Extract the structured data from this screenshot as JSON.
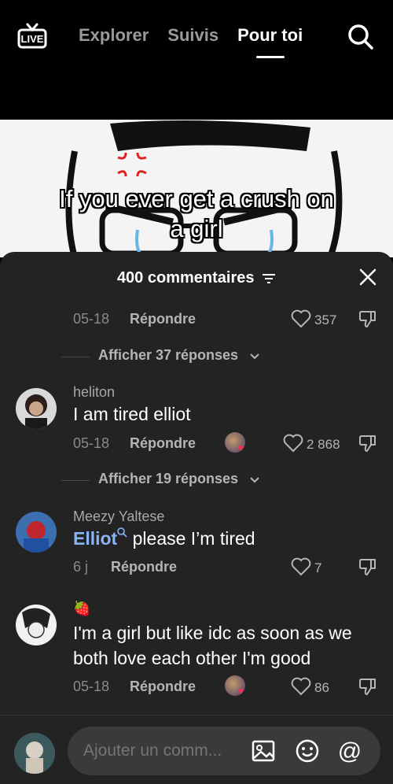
{
  "nav": {
    "live_label": "LIVE",
    "tabs": [
      {
        "label": "Explorer",
        "active": false
      },
      {
        "label": "Suivis",
        "active": false
      },
      {
        "label": "Pour toi",
        "active": true
      }
    ],
    "search_icon": "search-icon"
  },
  "video": {
    "caption_line1": "If you ever get a crush on",
    "caption_line2": "a girl"
  },
  "comments": {
    "count_label": "400 commentaires",
    "reply_label": "Répondre",
    "items": [
      {
        "date": "05-18",
        "likes": "357"
      },
      {
        "replies_label": "Afficher 37 réponses"
      },
      {
        "username": "heliton",
        "text": "I am tired elliot",
        "date": "05-18",
        "likes": "2 868",
        "liked_by_creator": true
      },
      {
        "replies_label": "Afficher 19 réponses"
      },
      {
        "username": "Meezy Yaltese",
        "mention": "Elliot",
        "text": " please I’m tired",
        "date": "6 j",
        "likes": "7"
      },
      {
        "username": "🍓",
        "text": "I'm a girl but like idc as soon as we both love each other I'm good",
        "date": "05-18",
        "likes": "86",
        "liked_by_creator": true
      }
    ]
  },
  "composer": {
    "placeholder": "Ajouter un comm..."
  },
  "colors": {
    "sheet_bg": "#232323",
    "mention": "#8ab4f8",
    "heart_accent": "#fe2c55"
  }
}
